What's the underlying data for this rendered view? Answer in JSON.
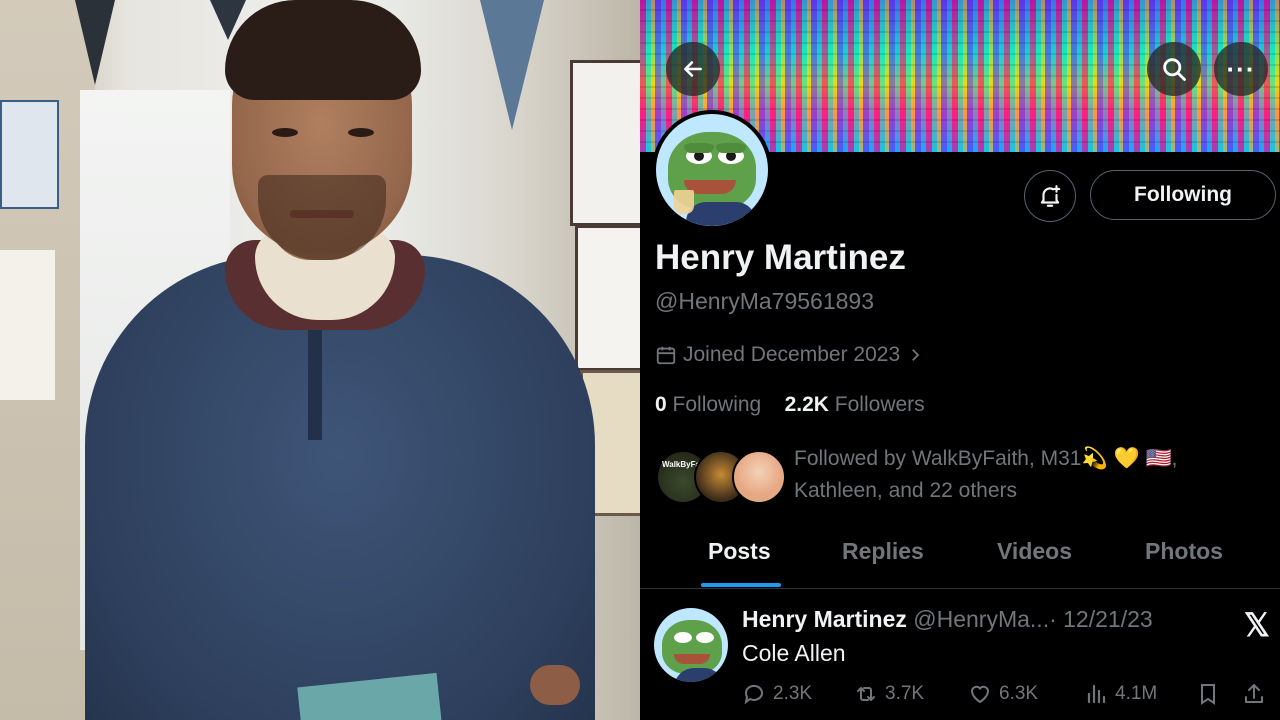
{
  "profile": {
    "display_name": "Henry Martinez",
    "handle": "@HenryMa79561893",
    "joined": "Joined December 2023",
    "following_count": "0",
    "following_label": "Following",
    "followers_count": "2.2K",
    "followers_label": "Followers",
    "followed_by_line1": "Followed by WalkByFaith, M31💫 💛 🇺🇸,",
    "followed_by_line2": "Kathleen, and 22 others",
    "mini_avatar_caption": "WalkByFaith",
    "follow_button_label": "Following"
  },
  "header": {
    "icons": [
      "back-arrow-icon",
      "search-icon",
      "more-icon"
    ],
    "more_label": "···"
  },
  "tabs": [
    {
      "label": "Posts",
      "active": true
    },
    {
      "label": "Replies",
      "active": false
    },
    {
      "label": "Videos",
      "active": false
    },
    {
      "label": "Photos",
      "active": false
    }
  ],
  "post": {
    "author": "Henry Martinez",
    "handle": "@HenryMa...",
    "date": "· 12/21/23",
    "text": "Cole Allen",
    "watermark": "𝕏",
    "actions": {
      "replies": "2.3K",
      "reposts": "3.7K",
      "likes": "6.3K",
      "views": "4.1M"
    }
  },
  "colors": {
    "accent": "#1d9bf0",
    "muted_text": "#71767b",
    "primary_text": "#eff3f4",
    "background": "#000000",
    "border": "#536471"
  }
}
